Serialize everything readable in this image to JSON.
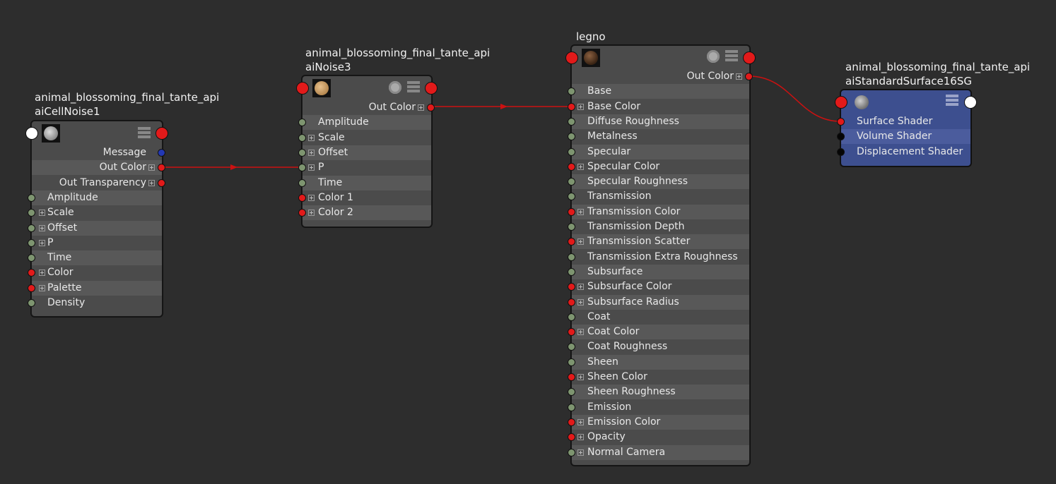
{
  "colors": {
    "background": "#2d2d2d",
    "wire": "#cc1111",
    "port_red": "#e21a1a",
    "port_green": "#7e9570",
    "port_blue": "#2338b4"
  },
  "nodes": {
    "cellnoise": {
      "title_line1": "animal_blossoming_final_tante_api",
      "title_line2": "aiCellNoise1",
      "thumb_icon": "cellnoise-thumbnail-icon",
      "outputs": [
        {
          "label": "Message",
          "expand": false,
          "port": "blue"
        },
        {
          "label": "Out Color",
          "expand": true,
          "port": "red"
        },
        {
          "label": "Out Transparency",
          "expand": true,
          "port": "red"
        }
      ],
      "inputs": [
        {
          "label": "Amplitude",
          "expand": false,
          "port": "green"
        },
        {
          "label": "Scale",
          "expand": true,
          "port": "green"
        },
        {
          "label": "Offset",
          "expand": true,
          "port": "green"
        },
        {
          "label": "P",
          "expand": true,
          "port": "green"
        },
        {
          "label": "Time",
          "expand": false,
          "port": "green"
        },
        {
          "label": "Color",
          "expand": true,
          "port": "red"
        },
        {
          "label": "Palette",
          "expand": true,
          "port": "red"
        },
        {
          "label": "Density",
          "expand": false,
          "port": "green"
        }
      ]
    },
    "noise": {
      "title_line1": "animal_blossoming_final_tante_api",
      "title_line2": "aiNoise3",
      "thumb_icon": "noise-thumbnail-icon",
      "outputs": [
        {
          "label": "Out Color",
          "expand": true,
          "port": "red"
        }
      ],
      "inputs": [
        {
          "label": "Amplitude",
          "expand": false,
          "port": "green"
        },
        {
          "label": "Scale",
          "expand": true,
          "port": "green"
        },
        {
          "label": "Offset",
          "expand": true,
          "port": "green"
        },
        {
          "label": "P",
          "expand": true,
          "port": "green"
        },
        {
          "label": "Time",
          "expand": false,
          "port": "green"
        },
        {
          "label": "Color 1",
          "expand": true,
          "port": "red"
        },
        {
          "label": "Color 2",
          "expand": true,
          "port": "red"
        }
      ]
    },
    "legno": {
      "title_line1": "legno",
      "thumb_icon": "material-ball-thumbnail-icon",
      "outputs": [
        {
          "label": "Out Color",
          "expand": true,
          "port": "red"
        }
      ],
      "inputs": [
        {
          "label": "Base",
          "expand": false,
          "port": "green"
        },
        {
          "label": "Base Color",
          "expand": true,
          "port": "red"
        },
        {
          "label": "Diffuse Roughness",
          "expand": false,
          "port": "green"
        },
        {
          "label": "Metalness",
          "expand": false,
          "port": "green"
        },
        {
          "label": "Specular",
          "expand": false,
          "port": "green"
        },
        {
          "label": "Specular Color",
          "expand": true,
          "port": "red"
        },
        {
          "label": "Specular Roughness",
          "expand": false,
          "port": "green"
        },
        {
          "label": "Transmission",
          "expand": false,
          "port": "green"
        },
        {
          "label": "Transmission Color",
          "expand": true,
          "port": "red"
        },
        {
          "label": "Transmission Depth",
          "expand": false,
          "port": "green"
        },
        {
          "label": "Transmission Scatter",
          "expand": true,
          "port": "red"
        },
        {
          "label": "Transmission Extra Roughness",
          "expand": false,
          "port": "green"
        },
        {
          "label": "Subsurface",
          "expand": false,
          "port": "green"
        },
        {
          "label": "Subsurface Color",
          "expand": true,
          "port": "red"
        },
        {
          "label": "Subsurface Radius",
          "expand": true,
          "port": "red"
        },
        {
          "label": "Coat",
          "expand": false,
          "port": "green"
        },
        {
          "label": "Coat Color",
          "expand": true,
          "port": "red"
        },
        {
          "label": "Coat Roughness",
          "expand": false,
          "port": "green"
        },
        {
          "label": "Sheen",
          "expand": false,
          "port": "green"
        },
        {
          "label": "Sheen Color",
          "expand": true,
          "port": "red"
        },
        {
          "label": "Sheen Roughness",
          "expand": false,
          "port": "green"
        },
        {
          "label": "Emission",
          "expand": false,
          "port": "green"
        },
        {
          "label": "Emission Color",
          "expand": true,
          "port": "red"
        },
        {
          "label": "Opacity",
          "expand": true,
          "port": "red"
        },
        {
          "label": "Normal Camera",
          "expand": true,
          "port": "green"
        }
      ]
    },
    "sg": {
      "title_line1": "animal_blossoming_final_tante_api",
      "title_line2": "aiStandardSurface16SG",
      "thumb_icon": "shading-group-thumbnail-icon",
      "inputs": [
        {
          "label": "Surface Shader",
          "expand": false,
          "port": "red"
        },
        {
          "label": "Volume Shader",
          "expand": false,
          "port": "black"
        },
        {
          "label": "Displacement Shader",
          "expand": false,
          "port": "black"
        }
      ]
    }
  }
}
